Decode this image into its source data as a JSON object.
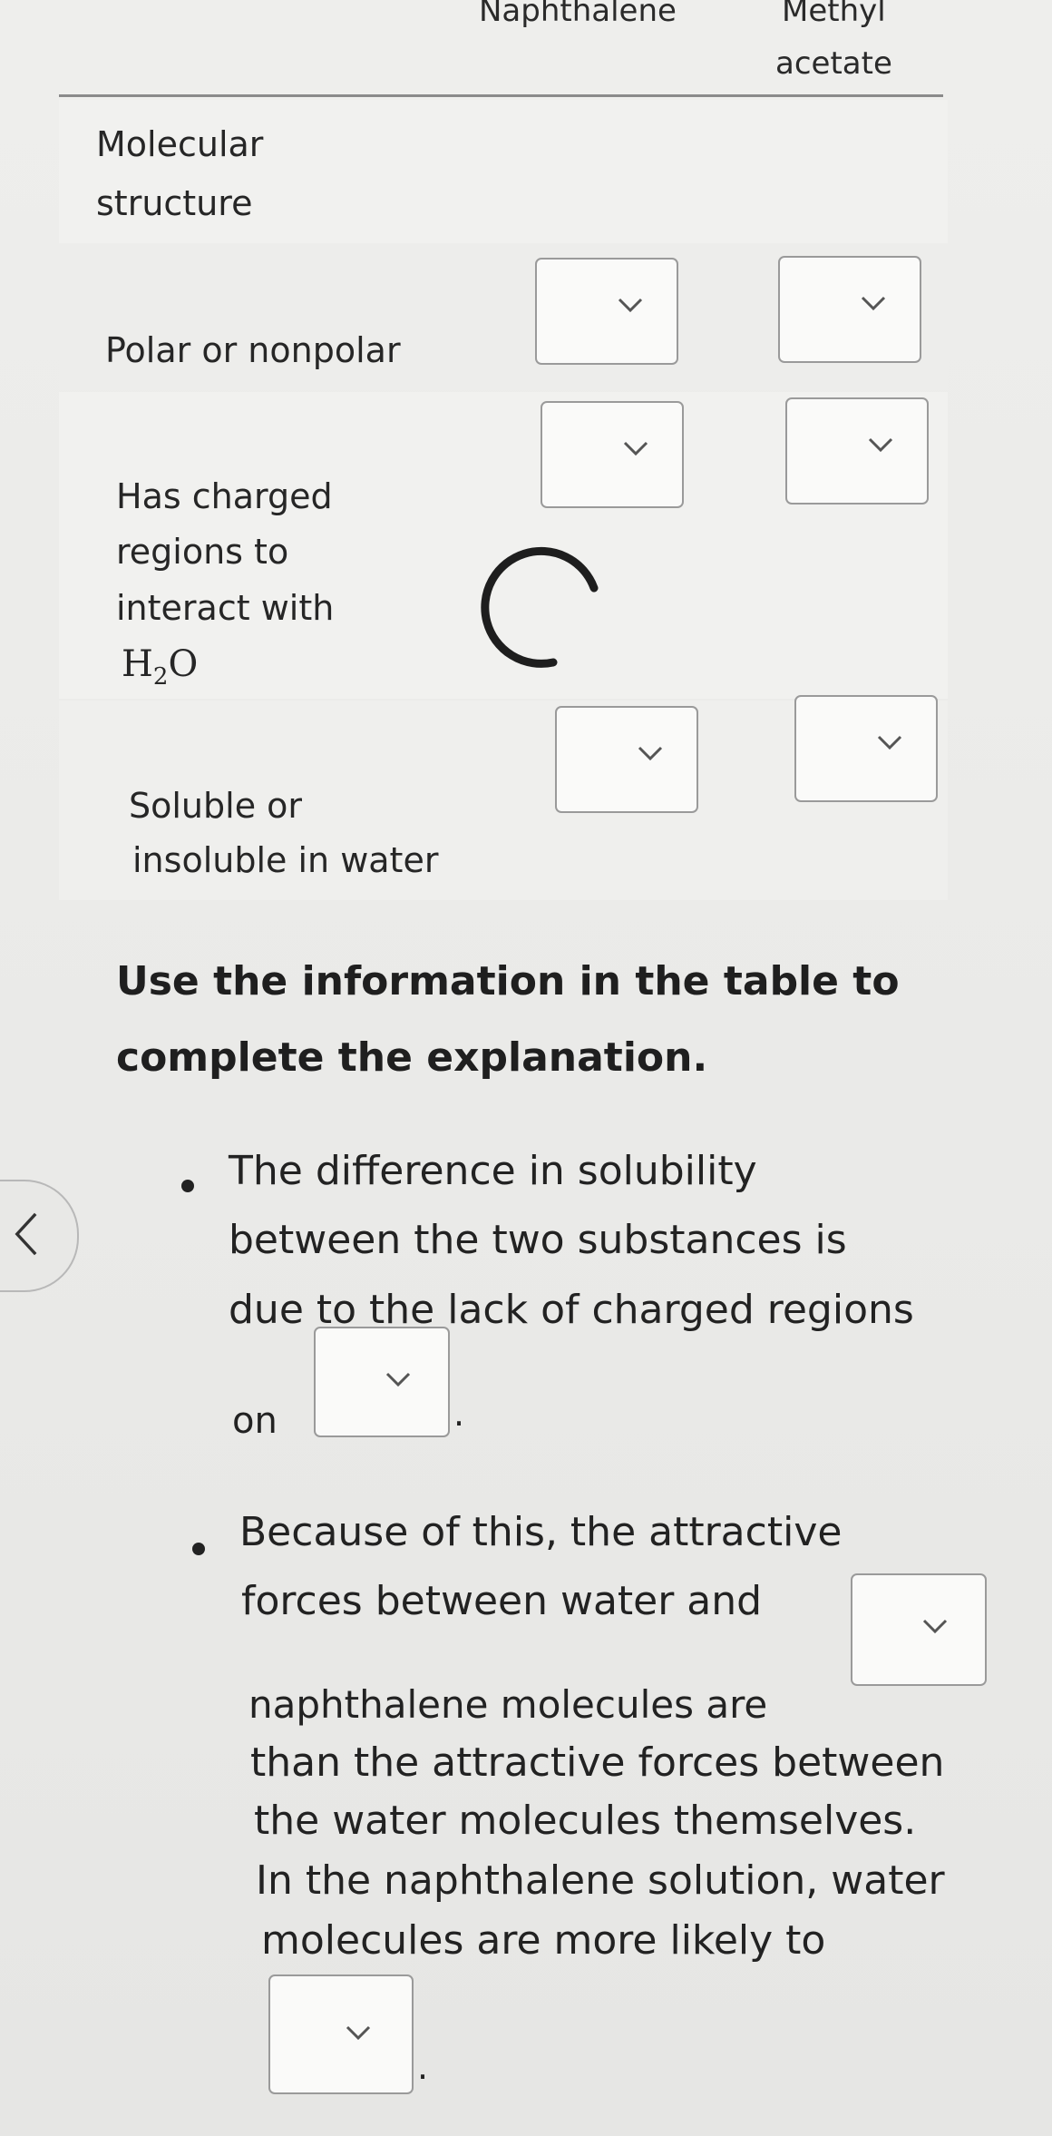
{
  "table": {
    "columns": [
      "Naphthalene",
      "Methyl acetate"
    ],
    "column_1_label": "Naphthalene",
    "column_2_line1": "Methyl",
    "column_2_line2": "acetate",
    "rows": [
      {
        "label_lines": [
          "Molecular",
          "structure"
        ]
      },
      {
        "label_lines": [
          "Polar or nonpolar"
        ]
      },
      {
        "label_lines": [
          "Has charged",
          "regions to",
          "interact with"
        ],
        "formula": "H",
        "formula_sub": "2",
        "formula_tail": "O"
      },
      {
        "label_lines": [
          "Soluble or",
          "insoluble in water"
        ]
      }
    ]
  },
  "instructions": "Use the information in the table to complete the explanation.",
  "instructions_lines": [
    "Use the information in the table to",
    "complete the explanation."
  ],
  "bullets": [
    {
      "lines": [
        "The difference in solubility",
        "between the two substances is",
        "due to the lack of charged regions"
      ],
      "tail_prefix": "on",
      "tail_suffix": "."
    },
    {
      "lines": [
        "Because of this, the attractive",
        "forces between water and"
      ],
      "inline_prefix": "naphthalene molecules are",
      "after_lines": [
        "than the attractive forces between",
        "the water molecules themselves.",
        "In the naphthalene solution, water",
        "molecules are more likely to"
      ],
      "tail_suffix": "."
    }
  ],
  "icons": {
    "dropdown": "chevron-down-icon",
    "back": "chevron-left-icon",
    "loading": "loading-spinner-icon"
  }
}
